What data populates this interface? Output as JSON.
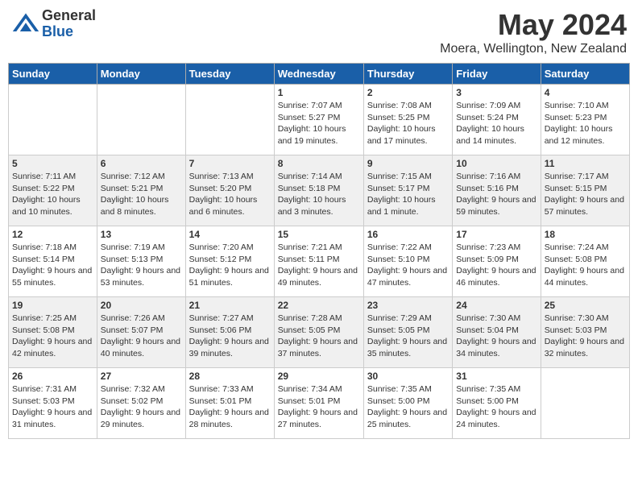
{
  "header": {
    "logo_general": "General",
    "logo_blue": "Blue",
    "month_title": "May 2024",
    "location": "Moera, Wellington, New Zealand"
  },
  "weekdays": [
    "Sunday",
    "Monday",
    "Tuesday",
    "Wednesday",
    "Thursday",
    "Friday",
    "Saturday"
  ],
  "weeks": [
    [
      {
        "day": "",
        "sunrise": "",
        "sunset": "",
        "daylight": ""
      },
      {
        "day": "",
        "sunrise": "",
        "sunset": "",
        "daylight": ""
      },
      {
        "day": "",
        "sunrise": "",
        "sunset": "",
        "daylight": ""
      },
      {
        "day": "1",
        "sunrise": "Sunrise: 7:07 AM",
        "sunset": "Sunset: 5:27 PM",
        "daylight": "Daylight: 10 hours and 19 minutes."
      },
      {
        "day": "2",
        "sunrise": "Sunrise: 7:08 AM",
        "sunset": "Sunset: 5:25 PM",
        "daylight": "Daylight: 10 hours and 17 minutes."
      },
      {
        "day": "3",
        "sunrise": "Sunrise: 7:09 AM",
        "sunset": "Sunset: 5:24 PM",
        "daylight": "Daylight: 10 hours and 14 minutes."
      },
      {
        "day": "4",
        "sunrise": "Sunrise: 7:10 AM",
        "sunset": "Sunset: 5:23 PM",
        "daylight": "Daylight: 10 hours and 12 minutes."
      }
    ],
    [
      {
        "day": "5",
        "sunrise": "Sunrise: 7:11 AM",
        "sunset": "Sunset: 5:22 PM",
        "daylight": "Daylight: 10 hours and 10 minutes."
      },
      {
        "day": "6",
        "sunrise": "Sunrise: 7:12 AM",
        "sunset": "Sunset: 5:21 PM",
        "daylight": "Daylight: 10 hours and 8 minutes."
      },
      {
        "day": "7",
        "sunrise": "Sunrise: 7:13 AM",
        "sunset": "Sunset: 5:20 PM",
        "daylight": "Daylight: 10 hours and 6 minutes."
      },
      {
        "day": "8",
        "sunrise": "Sunrise: 7:14 AM",
        "sunset": "Sunset: 5:18 PM",
        "daylight": "Daylight: 10 hours and 3 minutes."
      },
      {
        "day": "9",
        "sunrise": "Sunrise: 7:15 AM",
        "sunset": "Sunset: 5:17 PM",
        "daylight": "Daylight: 10 hours and 1 minute."
      },
      {
        "day": "10",
        "sunrise": "Sunrise: 7:16 AM",
        "sunset": "Sunset: 5:16 PM",
        "daylight": "Daylight: 9 hours and 59 minutes."
      },
      {
        "day": "11",
        "sunrise": "Sunrise: 7:17 AM",
        "sunset": "Sunset: 5:15 PM",
        "daylight": "Daylight: 9 hours and 57 minutes."
      }
    ],
    [
      {
        "day": "12",
        "sunrise": "Sunrise: 7:18 AM",
        "sunset": "Sunset: 5:14 PM",
        "daylight": "Daylight: 9 hours and 55 minutes."
      },
      {
        "day": "13",
        "sunrise": "Sunrise: 7:19 AM",
        "sunset": "Sunset: 5:13 PM",
        "daylight": "Daylight: 9 hours and 53 minutes."
      },
      {
        "day": "14",
        "sunrise": "Sunrise: 7:20 AM",
        "sunset": "Sunset: 5:12 PM",
        "daylight": "Daylight: 9 hours and 51 minutes."
      },
      {
        "day": "15",
        "sunrise": "Sunrise: 7:21 AM",
        "sunset": "Sunset: 5:11 PM",
        "daylight": "Daylight: 9 hours and 49 minutes."
      },
      {
        "day": "16",
        "sunrise": "Sunrise: 7:22 AM",
        "sunset": "Sunset: 5:10 PM",
        "daylight": "Daylight: 9 hours and 47 minutes."
      },
      {
        "day": "17",
        "sunrise": "Sunrise: 7:23 AM",
        "sunset": "Sunset: 5:09 PM",
        "daylight": "Daylight: 9 hours and 46 minutes."
      },
      {
        "day": "18",
        "sunrise": "Sunrise: 7:24 AM",
        "sunset": "Sunset: 5:08 PM",
        "daylight": "Daylight: 9 hours and 44 minutes."
      }
    ],
    [
      {
        "day": "19",
        "sunrise": "Sunrise: 7:25 AM",
        "sunset": "Sunset: 5:08 PM",
        "daylight": "Daylight: 9 hours and 42 minutes."
      },
      {
        "day": "20",
        "sunrise": "Sunrise: 7:26 AM",
        "sunset": "Sunset: 5:07 PM",
        "daylight": "Daylight: 9 hours and 40 minutes."
      },
      {
        "day": "21",
        "sunrise": "Sunrise: 7:27 AM",
        "sunset": "Sunset: 5:06 PM",
        "daylight": "Daylight: 9 hours and 39 minutes."
      },
      {
        "day": "22",
        "sunrise": "Sunrise: 7:28 AM",
        "sunset": "Sunset: 5:05 PM",
        "daylight": "Daylight: 9 hours and 37 minutes."
      },
      {
        "day": "23",
        "sunrise": "Sunrise: 7:29 AM",
        "sunset": "Sunset: 5:05 PM",
        "daylight": "Daylight: 9 hours and 35 minutes."
      },
      {
        "day": "24",
        "sunrise": "Sunrise: 7:30 AM",
        "sunset": "Sunset: 5:04 PM",
        "daylight": "Daylight: 9 hours and 34 minutes."
      },
      {
        "day": "25",
        "sunrise": "Sunrise: 7:30 AM",
        "sunset": "Sunset: 5:03 PM",
        "daylight": "Daylight: 9 hours and 32 minutes."
      }
    ],
    [
      {
        "day": "26",
        "sunrise": "Sunrise: 7:31 AM",
        "sunset": "Sunset: 5:03 PM",
        "daylight": "Daylight: 9 hours and 31 minutes."
      },
      {
        "day": "27",
        "sunrise": "Sunrise: 7:32 AM",
        "sunset": "Sunset: 5:02 PM",
        "daylight": "Daylight: 9 hours and 29 minutes."
      },
      {
        "day": "28",
        "sunrise": "Sunrise: 7:33 AM",
        "sunset": "Sunset: 5:01 PM",
        "daylight": "Daylight: 9 hours and 28 minutes."
      },
      {
        "day": "29",
        "sunrise": "Sunrise: 7:34 AM",
        "sunset": "Sunset: 5:01 PM",
        "daylight": "Daylight: 9 hours and 27 minutes."
      },
      {
        "day": "30",
        "sunrise": "Sunrise: 7:35 AM",
        "sunset": "Sunset: 5:00 PM",
        "daylight": "Daylight: 9 hours and 25 minutes."
      },
      {
        "day": "31",
        "sunrise": "Sunrise: 7:35 AM",
        "sunset": "Sunset: 5:00 PM",
        "daylight": "Daylight: 9 hours and 24 minutes."
      },
      {
        "day": "",
        "sunrise": "",
        "sunset": "",
        "daylight": ""
      }
    ]
  ]
}
